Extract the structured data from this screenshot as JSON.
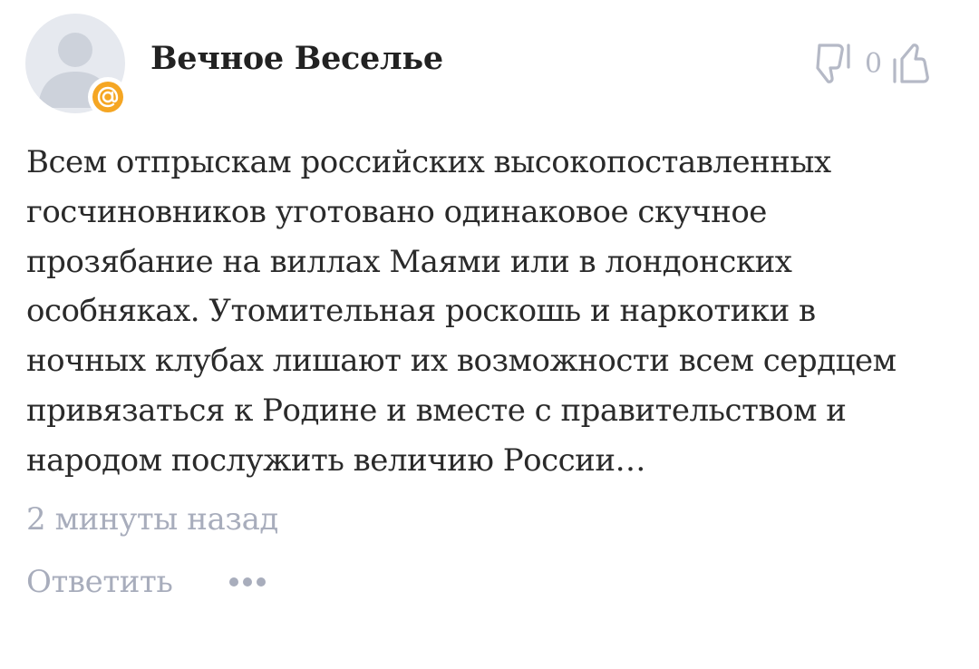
{
  "comment": {
    "author": "Вечное Веселье",
    "avatar_icon": "user-placeholder-icon",
    "badge_icon": "mail-at-icon",
    "badge_color": "#f5a623",
    "votes": {
      "down_icon": "thumb-down-icon",
      "count": "0",
      "up_icon": "thumb-up-icon"
    },
    "text_lines": [
      "Всем отпрыскам российских высокопоставленных",
      "госчиновников уготовано одинаковое скучное",
      "прозябание на виллах Маями или в лондонских",
      "особняках. Утомительная роскошь и наркотики в",
      "ночных клубах лишают их возможности всем сердцем",
      "привязаться к Родине и вместе с правительством и",
      "народом послужить величию России…"
    ],
    "time": "2 минуты назад",
    "reply_label": "Ответить",
    "more_icon": "more-dots-icon"
  }
}
